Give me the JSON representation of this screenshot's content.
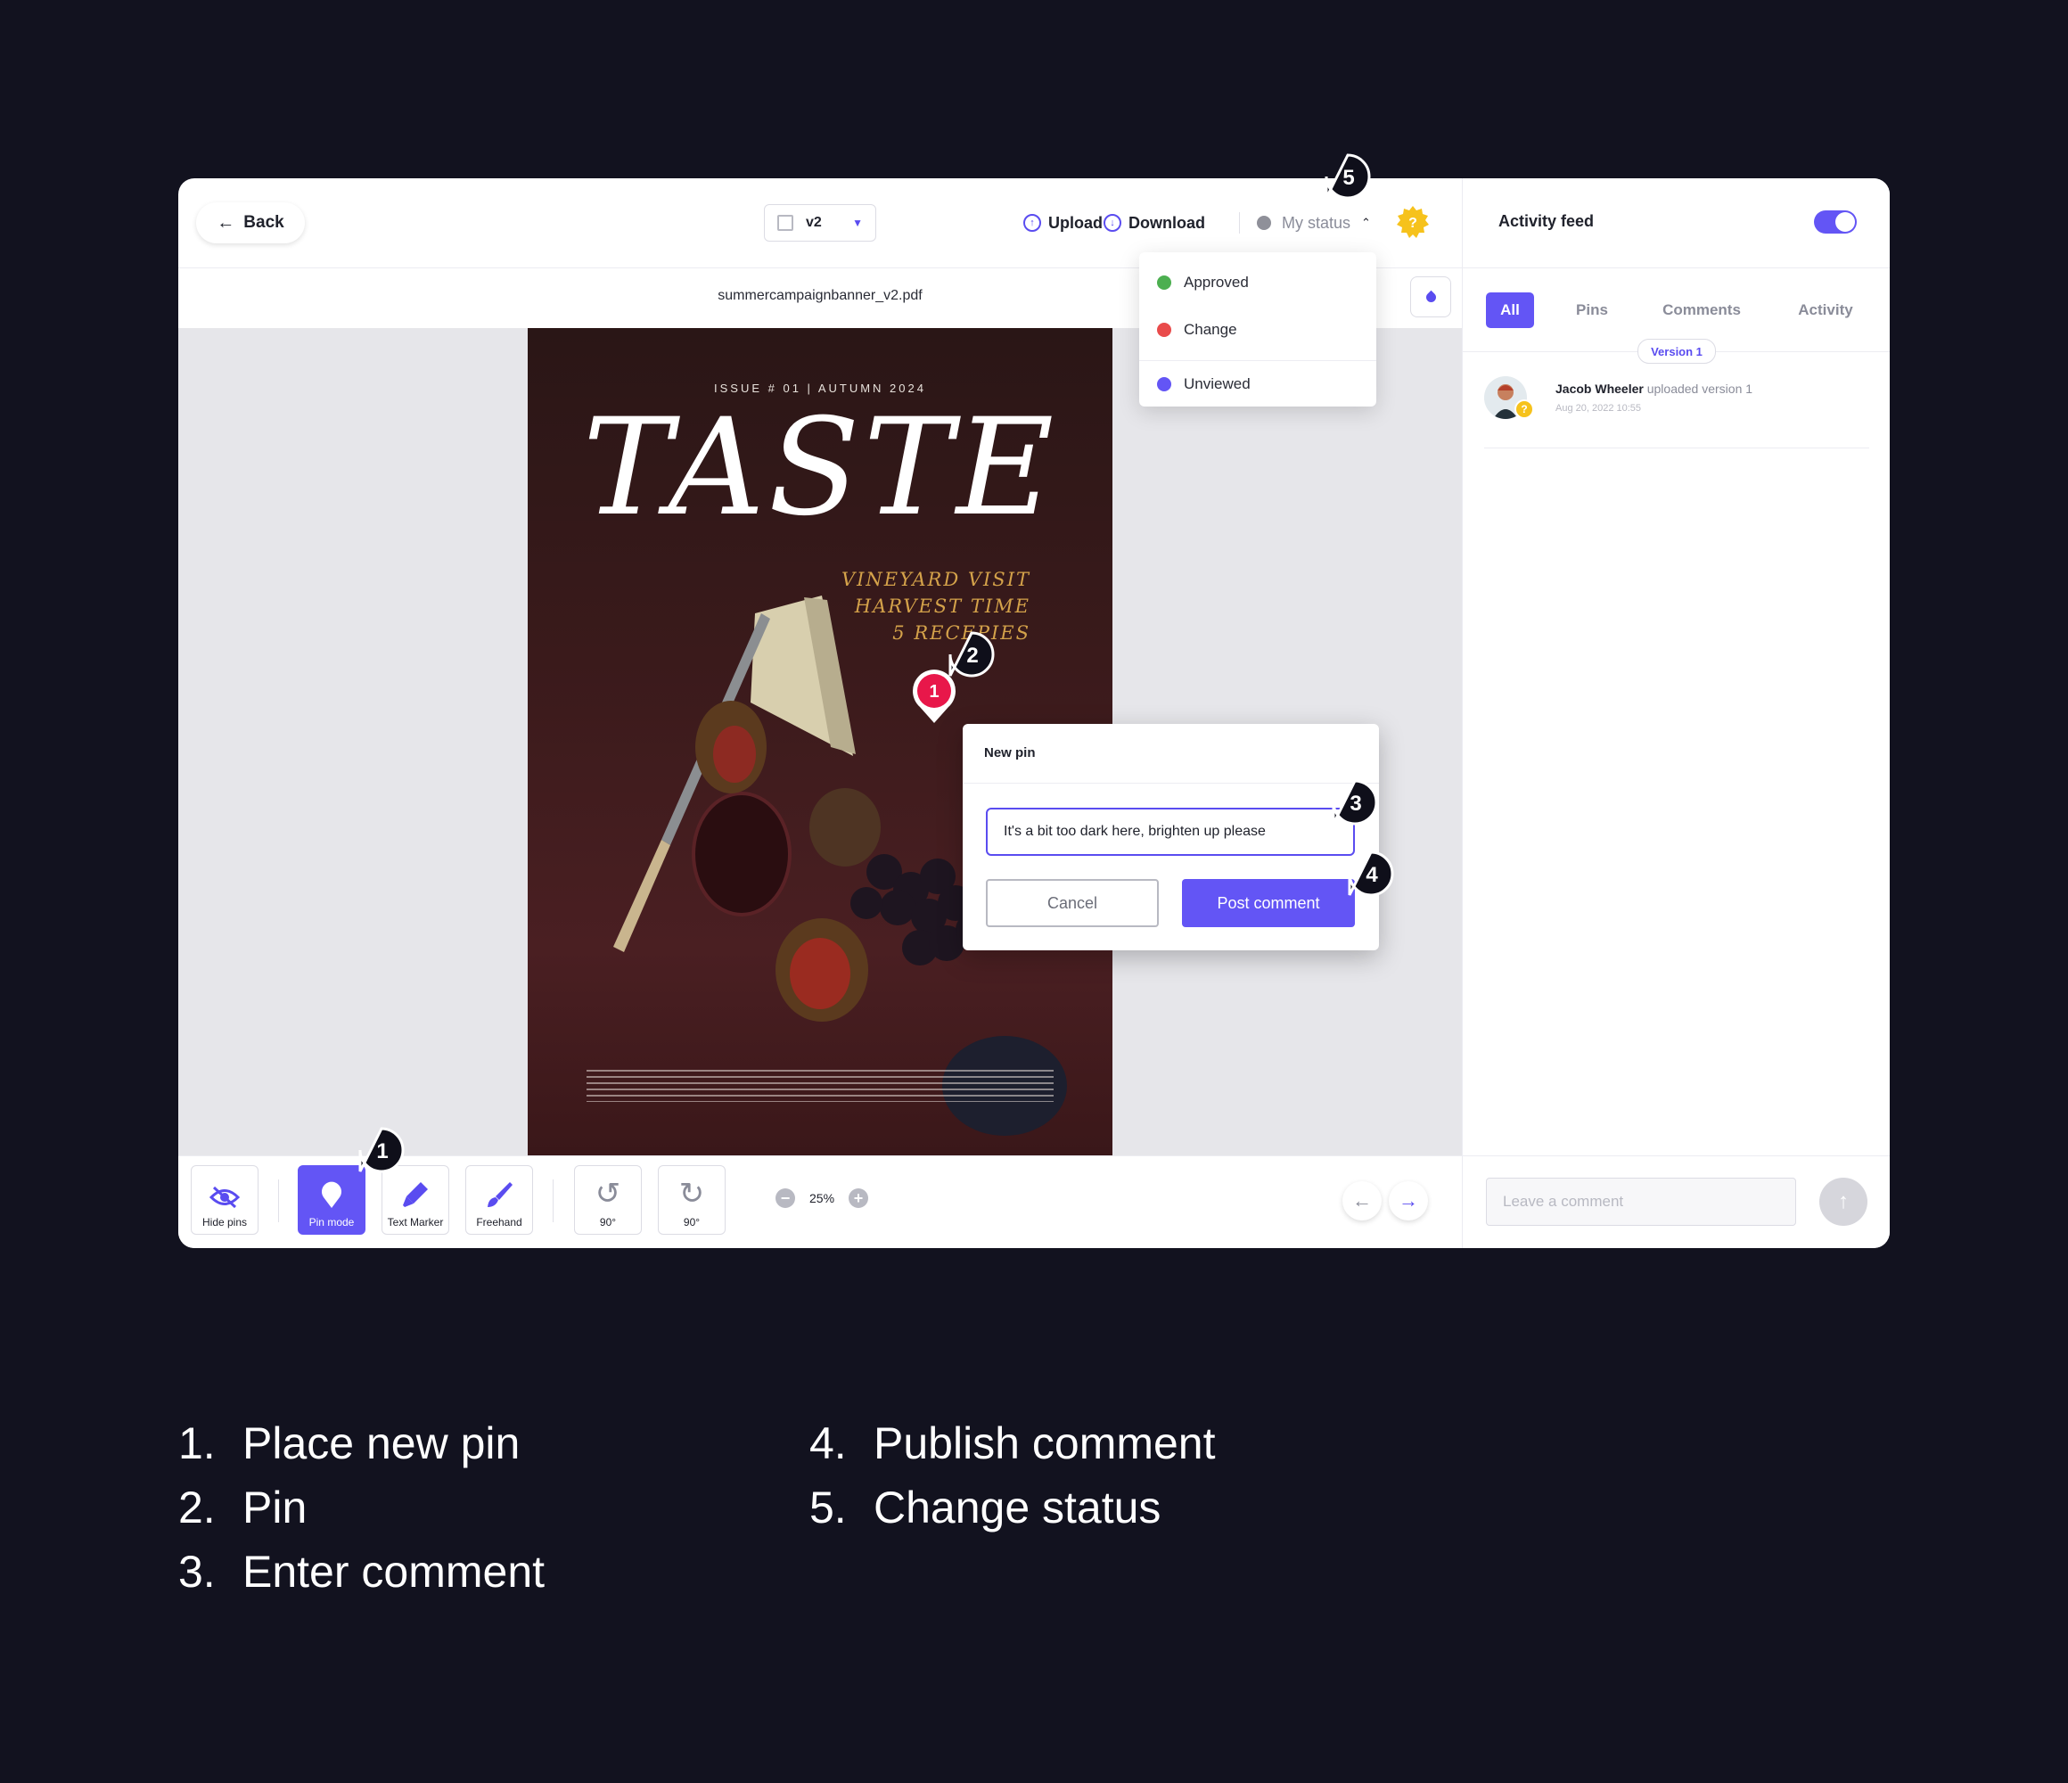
{
  "header": {
    "back_label": "Back",
    "version_value": "v2",
    "upload_label": "Upload",
    "download_label": "Download",
    "status_label": "My status",
    "status_badge": "?"
  },
  "status_menu": {
    "items": [
      {
        "label": "Approved",
        "color": "#4caf50"
      },
      {
        "label": "Change",
        "color": "#e94b4b"
      },
      {
        "label": "Unviewed",
        "color": "#6355f5"
      }
    ]
  },
  "document": {
    "filename": "summercampaignbanner_v2.pdf",
    "poster": {
      "issue": "ISSUE # 01 | AUTUMN 2024",
      "title": "TASTE",
      "taglines": [
        "VINEYARD VISIT",
        "HARVEST TIME",
        "5 RECEPIES"
      ]
    }
  },
  "new_pin": {
    "pin_number": "1",
    "title": "New pin",
    "comment_value": "It's a bit too dark here, brighten up please",
    "cancel_label": "Cancel",
    "post_label": "Post comment"
  },
  "callouts": [
    "1",
    "2",
    "3",
    "4",
    "5"
  ],
  "toolbar": {
    "hide_pins": "Hide pins",
    "pin_mode": "Pin mode",
    "text_marker": "Text Marker",
    "freehand": "Freehand",
    "rotate_left": "90°",
    "rotate_right": "90°",
    "zoom": "25%"
  },
  "activity": {
    "title": "Activity feed",
    "tabs": [
      "All",
      "Pins",
      "Comments",
      "Activity"
    ],
    "version_pill": "Version 1",
    "feed": [
      {
        "user": "Jacob Wheeler",
        "action": "uploaded version 1",
        "date": "Aug 20, 2022 10:55",
        "badge": "?"
      }
    ],
    "comment_placeholder": "Leave a comment"
  },
  "legend": [
    {
      "num": "1.",
      "text": "Place new pin"
    },
    {
      "num": "2.",
      "text": "Pin"
    },
    {
      "num": "3.",
      "text": "Enter comment"
    },
    {
      "num": "4.",
      "text": "Publish comment"
    },
    {
      "num": "5.",
      "text": "Change status"
    }
  ],
  "colors": {
    "accent": "#6355f5",
    "pin_red": "#e8174a",
    "background": "#12121f",
    "badge_yellow": "#f6c21c"
  }
}
